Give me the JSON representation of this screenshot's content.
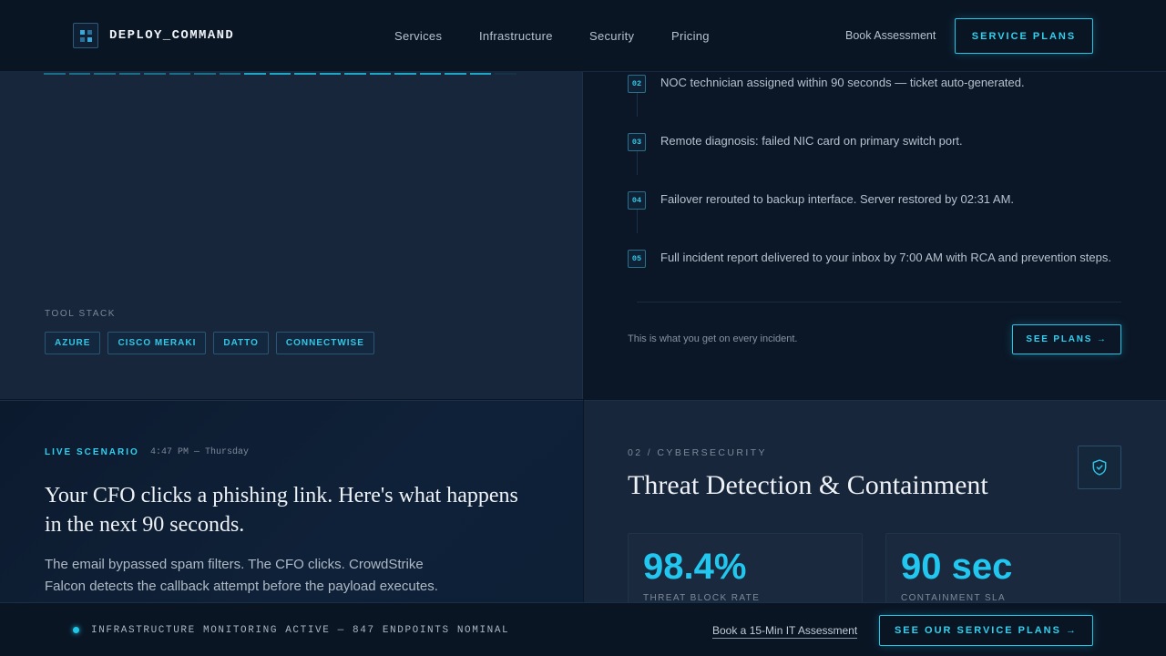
{
  "header": {
    "logo_text": "DEPLOY_COMMAND",
    "nav": [
      "Services",
      "Infrastructure",
      "Security",
      "Pricing"
    ],
    "book_label": "Book Assessment",
    "cta_label": "SERVICE PLANS"
  },
  "tools": {
    "label": "TOOL STACK",
    "tags": [
      "AZURE",
      "CISCO MERAKI",
      "DATTO",
      "CONNECTWISE"
    ]
  },
  "timeline": {
    "steps": [
      {
        "num": "02",
        "text": "NOC technician assigned within 90 seconds — ticket auto-generated."
      },
      {
        "num": "03",
        "text": "Remote diagnosis: failed NIC card on primary switch port."
      },
      {
        "num": "04",
        "text": "Failover rerouted to backup interface. Server restored by 02:31 AM."
      },
      {
        "num": "05",
        "text": "Full incident report delivered to your inbox by 7:00 AM with RCA and prevention steps."
      }
    ],
    "note": "This is what you get on every incident.",
    "cta_label": "SEE PLANS →"
  },
  "scenario": {
    "label": "LIVE SCENARIO",
    "time": "4:47 PM — Thursday",
    "title": "Your CFO clicks a phishing link. Here's what happens in the next 90 seconds.",
    "body": "The email bypassed spam filters. The CFO clicks. CrowdStrike Falcon detects the callback attempt before the payload executes."
  },
  "cyber": {
    "kicker": "02 / CYBERSECURITY",
    "title": "Threat Detection & Containment",
    "icon": "shield-check-icon",
    "stats": [
      {
        "value": "98.4%",
        "label": "THREAT BLOCK RATE"
      },
      {
        "value": "90 sec",
        "label": "CONTAINMENT SLA"
      }
    ]
  },
  "footer": {
    "status": "INFRASTRUCTURE MONITORING ACTIVE — 847 ENDPOINTS NOMINAL",
    "link": "Book a 15-Min IT Assessment",
    "cta_label": "SEE OUR SERVICE PLANS →"
  },
  "colors": {
    "accent": "#22c7e8",
    "background": "#0b1626",
    "panel": "#17263a"
  }
}
